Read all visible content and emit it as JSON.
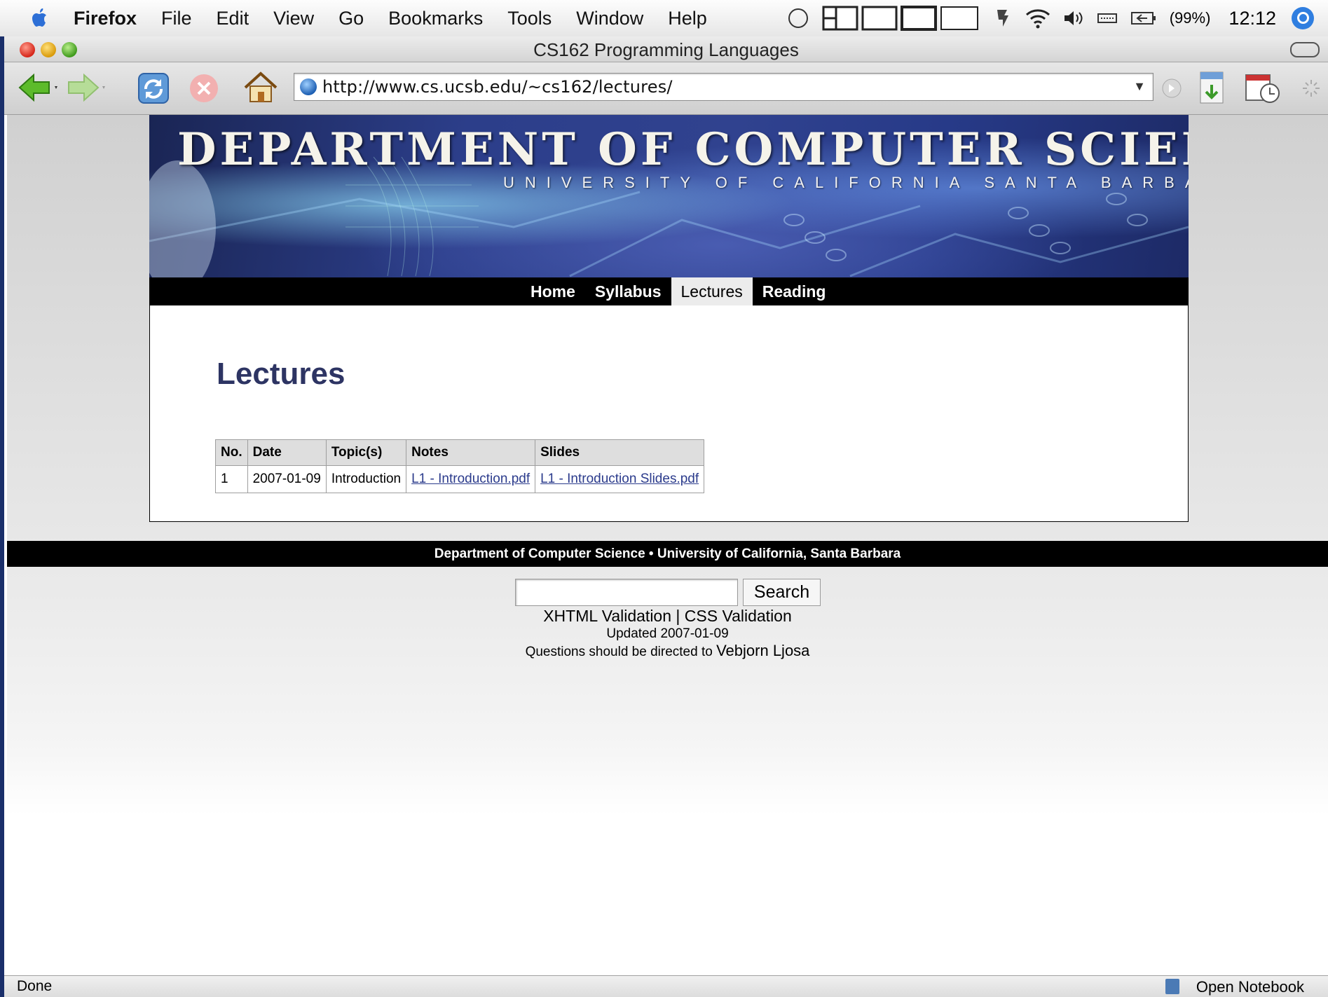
{
  "menubar": {
    "items": [
      "Firefox",
      "File",
      "Edit",
      "View",
      "Go",
      "Bookmarks",
      "Tools",
      "Window",
      "Help"
    ],
    "battery": "(99%)",
    "clock": "12:12"
  },
  "window": {
    "title": "CS162 Programming Languages"
  },
  "toolbar": {
    "url": "http://www.cs.ucsb.edu/~cs162/lectures/"
  },
  "banner": {
    "title": "DEPARTMENT OF COMPUTER SCIENCE",
    "subtitle": "UNIVERSITY OF CALIFORNIA SANTA BARBARA"
  },
  "nav": {
    "items": [
      "Home",
      "Syllabus",
      "Lectures",
      "Reading"
    ],
    "active": "Lectures"
  },
  "page": {
    "heading": "Lectures"
  },
  "lectures_table": {
    "headers": [
      "No.",
      "Date",
      "Topic(s)",
      "Notes",
      "Slides"
    ],
    "rows": [
      [
        "1",
        "2007-01-09",
        "Introduction",
        "L1 - Introduction.pdf",
        "L1 - Introduction Slides.pdf"
      ]
    ]
  },
  "footer": {
    "bar": "Department of Computer Science • University of California, Santa Barbara",
    "search_button": "Search",
    "validation": "XHTML Validation | CSS Validation",
    "updated": "Updated 2007-01-09",
    "questions": "Questions should be directed to",
    "contact": "Vebjorn Ljosa"
  },
  "statusbar": {
    "left": "Done",
    "right": "Open Notebook"
  },
  "colors": {
    "heading": "#2d3463",
    "link": "#2b3b8c",
    "nav_bg": "#000000",
    "nav_active_bg": "#ececec"
  }
}
